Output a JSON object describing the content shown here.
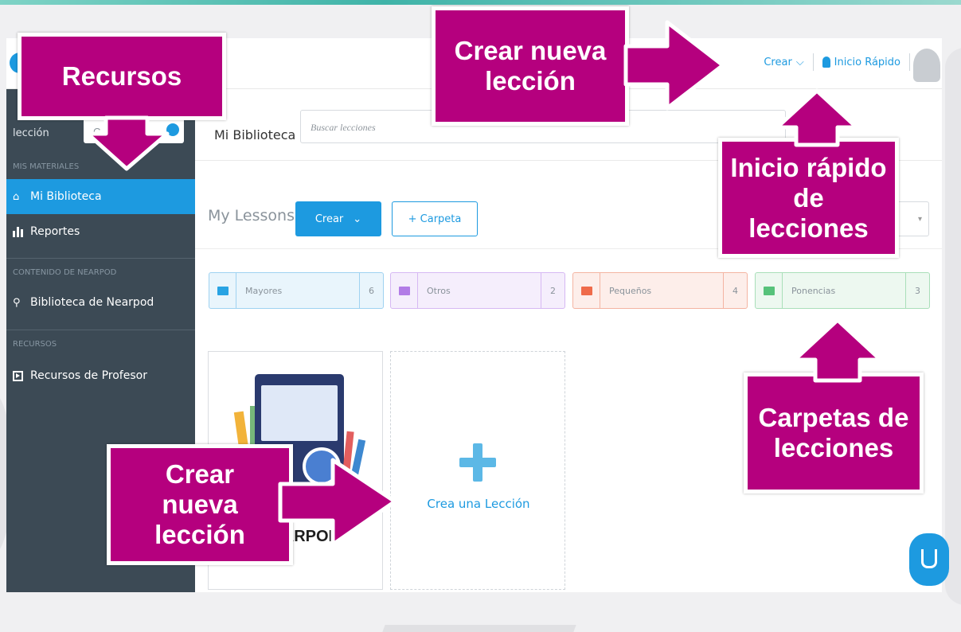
{
  "topnav": {
    "crear": "Crear",
    "inicio_rapido": "Inicio Rápido"
  },
  "sidebar": {
    "search_label": "lección",
    "search_value": "C",
    "sections": {
      "mis_materiales": "MIS MATERIALES",
      "contenido": "CONTENIDO DE NEARPOD",
      "recursos": "RECURSOS"
    },
    "items": [
      {
        "label": "Mi Biblioteca",
        "icon": "home-icon",
        "active": true
      },
      {
        "label": "Reportes",
        "icon": "reports-icon",
        "active": false
      },
      {
        "label": "Biblioteca de Nearpod",
        "icon": "search-icon",
        "active": false
      },
      {
        "label": "Recursos de Profesor",
        "icon": "resources-icon",
        "active": false
      }
    ]
  },
  "library": {
    "title": "Mi Biblioteca",
    "search_placeholder": "Buscar lecciones"
  },
  "lessons": {
    "title": "My Lessons",
    "create_label": "Crear",
    "folder_button": "+ Carpeta"
  },
  "folders": [
    {
      "name": "Mayores",
      "count": "6",
      "color": "#29a3e3"
    },
    {
      "name": "Otros",
      "count": "2",
      "color": "#b27ce6"
    },
    {
      "name": "Pequeños",
      "count": "4",
      "color": "#ef6b4a"
    },
    {
      "name": "Ponencias",
      "count": "3",
      "color": "#56c27a"
    }
  ],
  "cards": {
    "featured_text": "ECA D\nNEARPOD",
    "create_label": "Crea una Lección"
  },
  "callouts": {
    "recursos": "Recursos",
    "crear_top": "Crear nueva lección",
    "inicio": "Inicio rápido de lecciones",
    "carpetas": "Carpetas de lecciones",
    "crear_bottom": "Crear nueva lección"
  },
  "colors": {
    "accent": "#1d9ae0",
    "sidebar": "#3c4a55",
    "callout": "#b5007e"
  }
}
